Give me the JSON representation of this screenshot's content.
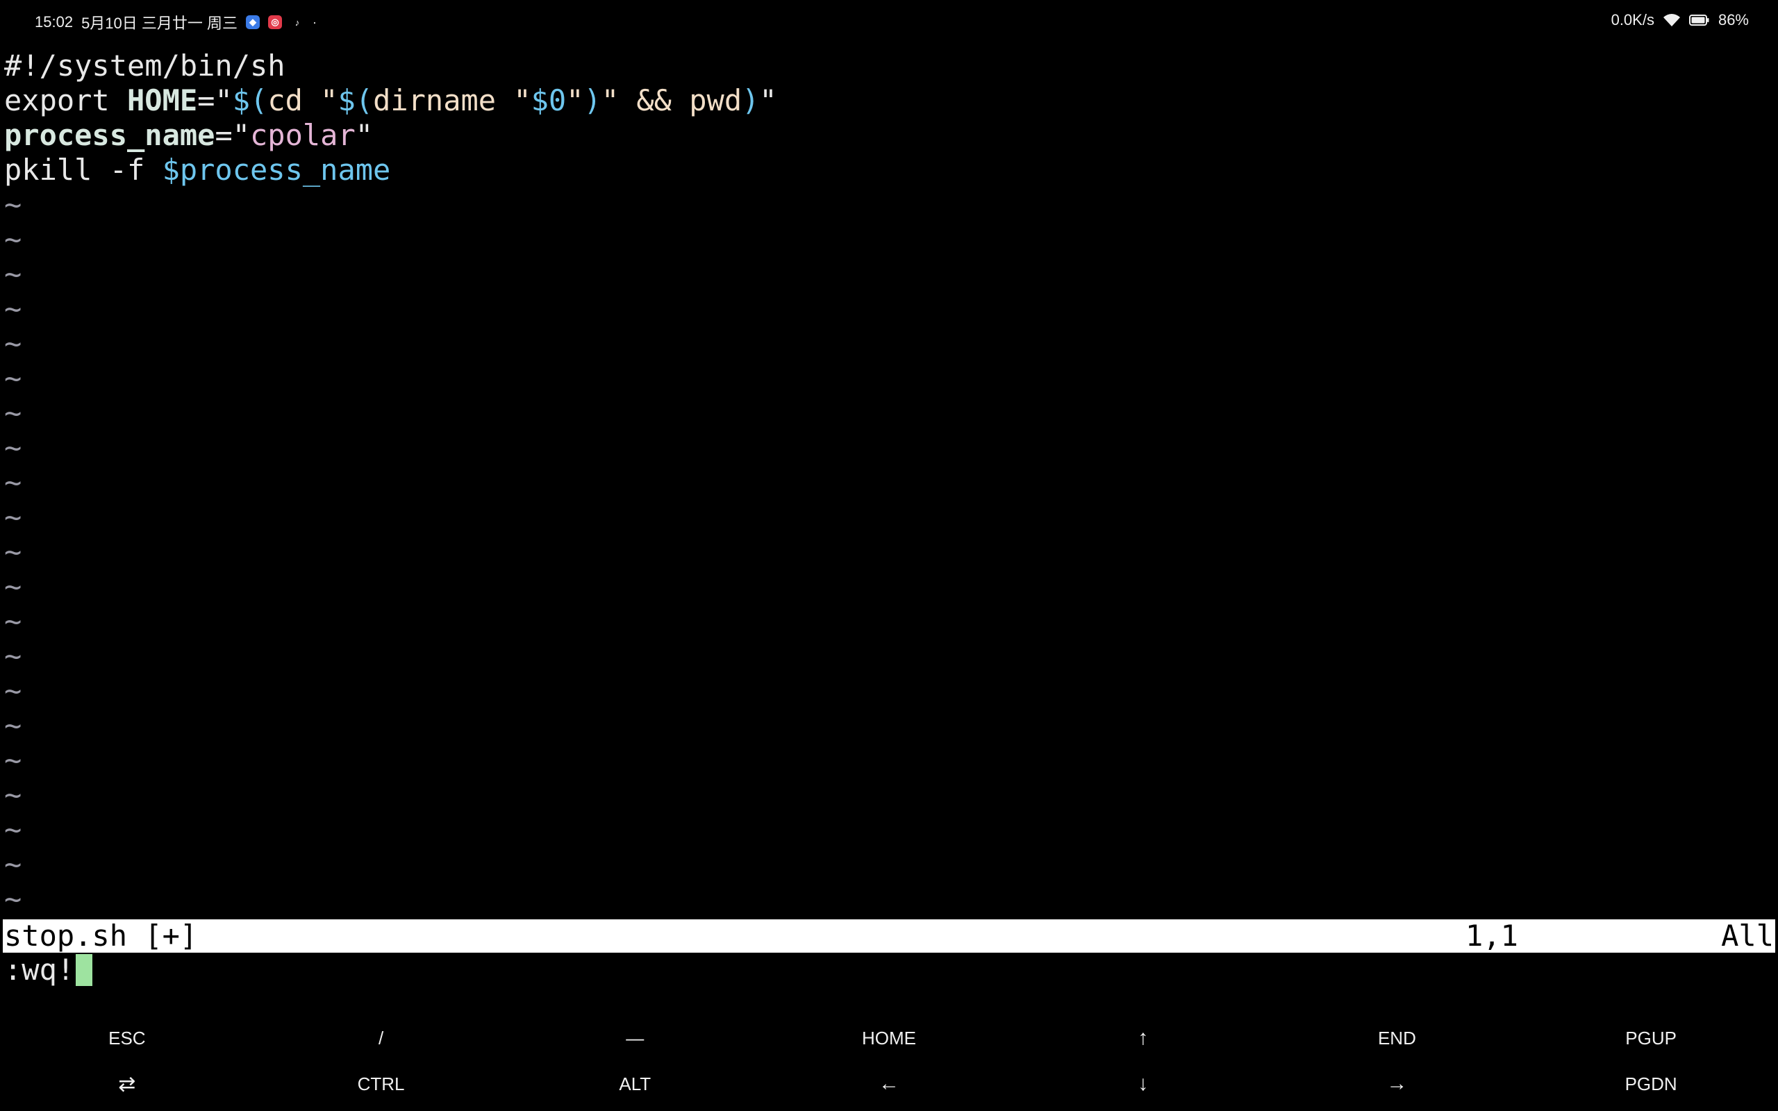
{
  "status_bar": {
    "time": "15:02",
    "date": "5月10日 三月廿一 周三",
    "dot": "·",
    "net_speed": "0.0K/s",
    "battery": "86%",
    "icons": [
      "app-icon-blue",
      "app-icon-red",
      "tiktok-icon",
      "wifi-icon",
      "battery-icon"
    ]
  },
  "editor": {
    "lines": [
      {
        "segments": [
          {
            "t": "#!/system/bin/sh",
            "c": "c-plain"
          }
        ]
      },
      {
        "segments": [
          {
            "t": "export ",
            "c": "c-kw"
          },
          {
            "t": "HOME",
            "c": "c-var"
          },
          {
            "t": "=\"",
            "c": "c-plain"
          },
          {
            "t": "$(",
            "c": "c-blue"
          },
          {
            "t": "cd \"",
            "c": "c-brown"
          },
          {
            "t": "$(",
            "c": "c-blue"
          },
          {
            "t": "dirname \"",
            "c": "c-brown"
          },
          {
            "t": "$0",
            "c": "c-blue"
          },
          {
            "t": "\"",
            "c": "c-brown"
          },
          {
            "t": ")",
            "c": "c-blue"
          },
          {
            "t": "\" && pwd",
            "c": "c-brown"
          },
          {
            "t": ")",
            "c": "c-blue"
          },
          {
            "t": "\"",
            "c": "c-plain"
          }
        ]
      },
      {
        "segments": [
          {
            "t": "process_name",
            "c": "c-var"
          },
          {
            "t": "=\"",
            "c": "c-plain"
          },
          {
            "t": "cpolar",
            "c": "c-str"
          },
          {
            "t": "\"",
            "c": "c-plain"
          }
        ]
      },
      {
        "segments": [
          {
            "t": "pkill -f ",
            "c": "c-plain"
          },
          {
            "t": "$process_name",
            "c": "c-blue"
          }
        ]
      }
    ],
    "empty_marker": "~",
    "empty_line_count": 21
  },
  "vim_status": {
    "filename": "stop.sh [+]",
    "position": "1,1",
    "scroll": "All"
  },
  "command_line": {
    "text": ":wq!"
  },
  "extra_keys": {
    "row1": [
      "ESC",
      "/",
      "—",
      "HOME",
      "↑",
      "END",
      "PGUP"
    ],
    "row2": [
      "⇄",
      "CTRL",
      "ALT",
      "←",
      "↓",
      "→",
      "PGDN"
    ]
  },
  "colors": {
    "background": "#000000",
    "status_line_bg": "#ffffff",
    "cursor": "#9ee3a0",
    "blue": "#6ec6ee",
    "string": "#e4b5d6"
  }
}
